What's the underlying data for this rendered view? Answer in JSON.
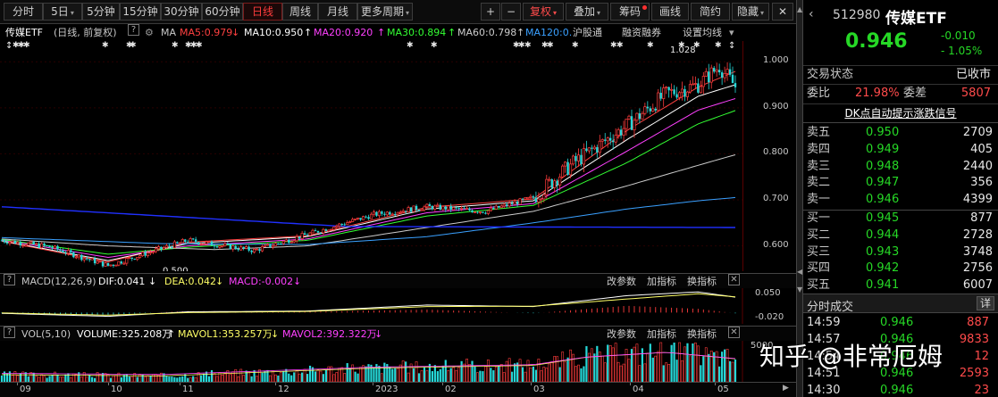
{
  "toolbar": {
    "periods": [
      {
        "label": "分时",
        "caret": false,
        "active": false
      },
      {
        "label": "5日",
        "caret": true,
        "active": false
      },
      {
        "label": "5分钟",
        "caret": false,
        "active": false
      },
      {
        "label": "15分钟",
        "caret": false,
        "active": false
      },
      {
        "label": "30分钟",
        "caret": false,
        "active": false
      },
      {
        "label": "60分钟",
        "caret": false,
        "active": false
      },
      {
        "label": "日线",
        "caret": false,
        "active": true
      },
      {
        "label": "周线",
        "caret": false,
        "active": false
      },
      {
        "label": "月线",
        "caret": false,
        "active": false
      },
      {
        "label": "更多周期",
        "caret": true,
        "active": false
      }
    ],
    "zoom_in": "+",
    "zoom_out": "−",
    "adjust": "复权",
    "overlay": "叠加",
    "chips": "筹码",
    "drawing": "画线",
    "simple": "简约",
    "hide": "隐藏",
    "close": "✕"
  },
  "ma_row": {
    "name": "传媒ETF",
    "desc": "(日线, 前复权)",
    "help": "?",
    "ma_label": "MA",
    "ma5": "MA5:0.979",
    "ma10": "MA10:0.950",
    "ma20": "MA20:0.920",
    "ma30": "MA30:0.894",
    "ma60": "MA60:0.798",
    "ma120": "MA120:0.",
    "hgt": "沪股通",
    "margin": "融资融券",
    "settings": "设置均线",
    "colors": {
      "ma5": "#ff4040",
      "ma10": "#ffffff",
      "ma20": "#ff40ff",
      "ma30": "#33ff33",
      "ma60": "#cccccc",
      "ma120": "#3aa0ff"
    }
  },
  "chart_data": [
    {
      "type": "candlestick",
      "title": "传媒ETF",
      "x_ticks": [
        "09",
        "10",
        "11",
        "12",
        "2023",
        "02",
        "03",
        "04",
        "05"
      ],
      "y_ticks": [
        "1.000",
        "0.900",
        "0.800",
        "0.700",
        "0.600"
      ],
      "ylim": [
        0.545,
        1.045
      ],
      "annotations": [
        {
          "label": "1.028"
        },
        {
          "label": "0.500"
        }
      ],
      "anchors": [
        [
          0,
          0.612
        ],
        [
          18,
          0.598
        ],
        [
          40,
          0.557
        ],
        [
          55,
          0.585
        ],
        [
          70,
          0.612
        ],
        [
          95,
          0.59
        ],
        [
          115,
          0.625
        ],
        [
          140,
          0.668
        ],
        [
          160,
          0.685
        ],
        [
          182,
          0.675
        ],
        [
          200,
          0.705
        ],
        [
          215,
          0.78
        ],
        [
          235,
          0.86
        ],
        [
          250,
          0.93
        ],
        [
          262,
          0.95
        ],
        [
          270,
          0.99
        ],
        [
          276,
          0.946
        ]
      ],
      "series": [
        {
          "name": "MA5",
          "color": "#ff4040",
          "values": [
            [
              0,
              0.61
            ],
            [
              40,
              0.565
            ],
            [
              70,
              0.608
            ],
            [
              115,
              0.622
            ],
            [
              160,
              0.684
            ],
            [
              200,
              0.702
            ],
            [
              235,
              0.85
            ],
            [
              262,
              0.945
            ],
            [
              276,
              0.979
            ]
          ]
        },
        {
          "name": "MA10",
          "color": "#ffffff",
          "values": [
            [
              0,
              0.611
            ],
            [
              40,
              0.568
            ],
            [
              70,
              0.605
            ],
            [
              115,
              0.62
            ],
            [
              160,
              0.68
            ],
            [
              200,
              0.698
            ],
            [
              235,
              0.83
            ],
            [
              262,
              0.925
            ],
            [
              276,
              0.95
            ]
          ]
        },
        {
          "name": "MA20",
          "color": "#ff40ff",
          "values": [
            [
              0,
              0.613
            ],
            [
              40,
              0.575
            ],
            [
              70,
              0.6
            ],
            [
              115,
              0.615
            ],
            [
              160,
              0.672
            ],
            [
              200,
              0.692
            ],
            [
              235,
              0.805
            ],
            [
              262,
              0.895
            ],
            [
              276,
              0.92
            ]
          ]
        },
        {
          "name": "MA30",
          "color": "#33ff33",
          "values": [
            [
              0,
              0.614
            ],
            [
              40,
              0.582
            ],
            [
              70,
              0.597
            ],
            [
              115,
              0.612
            ],
            [
              160,
              0.665
            ],
            [
              200,
              0.688
            ],
            [
              235,
              0.78
            ],
            [
              262,
              0.865
            ],
            [
              276,
              0.894
            ]
          ]
        },
        {
          "name": "MA60",
          "color": "#cccccc",
          "values": [
            [
              0,
              0.615
            ],
            [
              40,
              0.6
            ],
            [
              80,
              0.592
            ],
            [
              115,
              0.6
            ],
            [
              160,
              0.64
            ],
            [
              200,
              0.675
            ],
            [
              235,
              0.73
            ],
            [
              262,
              0.775
            ],
            [
              276,
              0.798
            ]
          ]
        },
        {
          "name": "MA120",
          "color": "#3aa0ff",
          "values": [
            [
              0,
              0.618
            ],
            [
              60,
              0.605
            ],
            [
              115,
              0.603
            ],
            [
              160,
              0.62
            ],
            [
              200,
              0.65
            ],
            [
              235,
              0.68
            ],
            [
              262,
              0.698
            ],
            [
              276,
              0.705
            ]
          ]
        },
        {
          "name": "",
          "color": "#2030ff",
          "values": [
            [
              0,
              0.685
            ],
            [
              130,
              0.642
            ],
            [
              276,
              0.64
            ]
          ]
        }
      ]
    },
    {
      "type": "macd",
      "header": "MACD(12,26,9)",
      "dif": "DIF:0.041",
      "dea": "DEA:0.042",
      "macd": "MACD:-0.002",
      "y_ticks": [
        "0.050",
        "-0.020"
      ],
      "ylim": [
        -0.03,
        0.065
      ],
      "dif_values": [
        [
          0,
          -0.002
        ],
        [
          40,
          -0.01
        ],
        [
          70,
          0.002
        ],
        [
          115,
          0.004
        ],
        [
          160,
          0.02
        ],
        [
          200,
          0.016
        ],
        [
          235,
          0.045
        ],
        [
          262,
          0.055
        ],
        [
          276,
          0.041
        ]
      ],
      "dea_values": [
        [
          0,
          -0.001
        ],
        [
          40,
          -0.007
        ],
        [
          70,
          0.0
        ],
        [
          115,
          0.003
        ],
        [
          160,
          0.016
        ],
        [
          200,
          0.017
        ],
        [
          235,
          0.036
        ],
        [
          262,
          0.05
        ],
        [
          276,
          0.042
        ]
      ]
    },
    {
      "type": "bar",
      "header": "VOL(5,10)",
      "volume": "VOLUME:325.208万",
      "mavol1": "MAVOL1:353.257万",
      "mavol2": "MAVOL2:392.322万",
      "y_ticks": [
        "5000"
      ],
      "profile": [
        [
          0,
          0.22
        ],
        [
          60,
          0.18
        ],
        [
          100,
          0.3
        ],
        [
          140,
          0.42
        ],
        [
          200,
          0.5
        ],
        [
          220,
          0.75
        ],
        [
          250,
          0.9
        ],
        [
          276,
          0.7
        ]
      ]
    }
  ],
  "panel_tools": {
    "params": "改参数",
    "add_indicator": "加指标",
    "switch_indicator": "换指标",
    "caret": "▾"
  },
  "date_axis": [
    "09",
    "10",
    "11",
    "12",
    "2023",
    "02",
    "03",
    "04",
    "05"
  ],
  "watermark": "知乎 @非常厄姆",
  "quote": {
    "code": "512980",
    "name": "传媒ETF",
    "price": "0.946",
    "change": "-0.010",
    "change_pct": "- 1.05%",
    "trade_status_label": "交易状态",
    "trade_status_value": "已收市",
    "weibi_label": "委比",
    "weibi_value": "21.98%",
    "weicha_label": "委差",
    "weicha_value": "5807",
    "signal": "DK点自动提示涨跌信号",
    "asks": [
      {
        "label": "卖五",
        "price": "0.950",
        "vol": "2709"
      },
      {
        "label": "卖四",
        "price": "0.949",
        "vol": "405"
      },
      {
        "label": "卖三",
        "price": "0.948",
        "vol": "2440"
      },
      {
        "label": "卖二",
        "price": "0.947",
        "vol": "356"
      },
      {
        "label": "卖一",
        "price": "0.946",
        "vol": "4399"
      }
    ],
    "bids": [
      {
        "label": "买一",
        "price": "0.945",
        "vol": "877"
      },
      {
        "label": "买二",
        "price": "0.944",
        "vol": "2728"
      },
      {
        "label": "买三",
        "price": "0.943",
        "vol": "3748"
      },
      {
        "label": "买四",
        "price": "0.942",
        "vol": "2756"
      },
      {
        "label": "买五",
        "price": "0.941",
        "vol": "6007"
      }
    ],
    "ticks_title": "分时成交",
    "ticks_more": "详",
    "ticks": [
      {
        "time": "14:59",
        "price": "0.946",
        "vol": "887"
      },
      {
        "time": "14:57",
        "price": "0.946",
        "vol": "9833"
      },
      {
        "time": "14:54",
        "price": "0.946",
        "vol": "12"
      },
      {
        "time": "14:51",
        "price": "0.946",
        "vol": "2593"
      },
      {
        "time": "14:30",
        "price": "0.946",
        "vol": "23"
      }
    ]
  },
  "colors": {
    "up": "#ff3c3c",
    "down": "#26d8d8",
    "green": "#26d826"
  }
}
